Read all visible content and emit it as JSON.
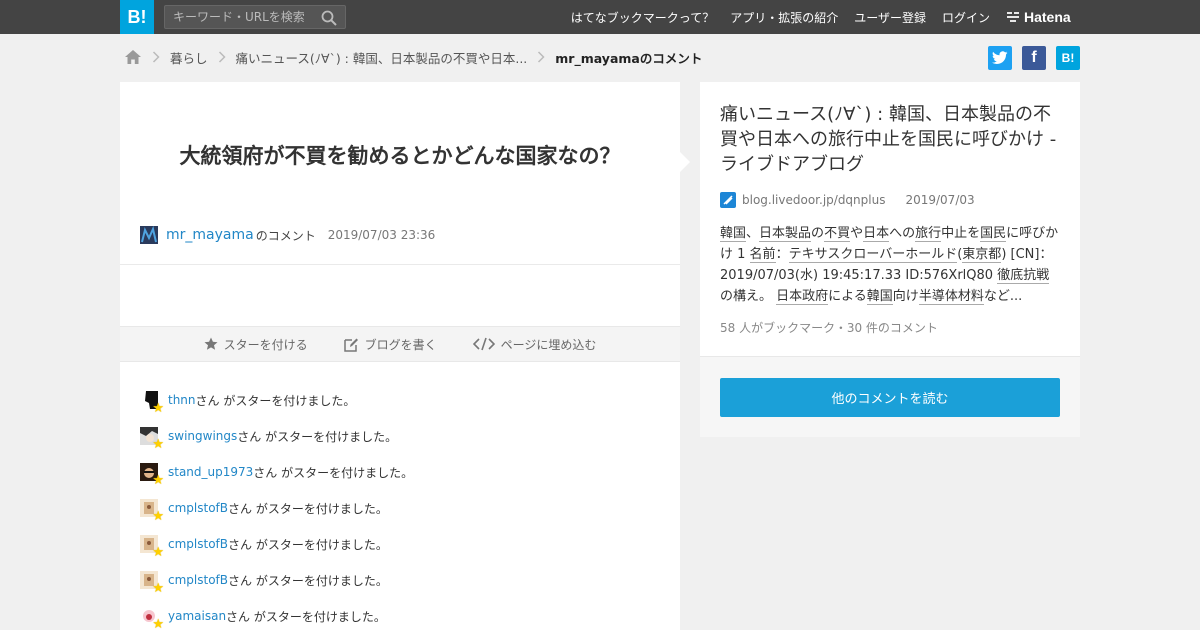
{
  "header": {
    "logo": "B!",
    "search_placeholder": "キーワード・URLを検索",
    "nav": [
      "はてなブックマークって？",
      "アプリ・拡張の紹介",
      "ユーザー登録",
      "ログイン"
    ],
    "brand": "Hatena"
  },
  "breadcrumb": {
    "items": [
      "暮らし",
      "痛いニュース(ﾉ∀`) : 韓国、日本製品の不買や日本..."
    ],
    "current": "mr_mayamaのコメント"
  },
  "share": {
    "twitter": "t",
    "facebook": "f",
    "hatena": "B!"
  },
  "comment": {
    "text": "大統領府が不買を勧めるとかどんな国家なの？",
    "user": "mr_mayama",
    "suffix": "のコメント",
    "date": "2019/07/03 23:36"
  },
  "actions": {
    "star": "スターを付ける",
    "blog": "ブログを書く",
    "embed": "ページに埋め込む"
  },
  "star_suffix": "さん がスターを付けました。",
  "stars": [
    {
      "user": "thnn"
    },
    {
      "user": "swingwings"
    },
    {
      "user": "stand_up1973"
    },
    {
      "user": "cmplstofB"
    },
    {
      "user": "cmplstofB"
    },
    {
      "user": "cmplstofB"
    },
    {
      "user": "yamaisan"
    }
  ],
  "entry": {
    "title": "痛いニュース(ﾉ∀`) : 韓国、日本製品の不買や日本への旅行中止を国民に呼びかけ - ライブドアブログ",
    "domain": "blog.livedoor.jp/dqnplus",
    "date": "2019/07/03",
    "desc_parts": [
      {
        "t": "韓国",
        "u": true
      },
      {
        "t": "、",
        "u": false
      },
      {
        "t": "日本製品",
        "u": true
      },
      {
        "t": "の",
        "u": false
      },
      {
        "t": "不買",
        "u": true
      },
      {
        "t": "や",
        "u": false
      },
      {
        "t": "日本",
        "u": true
      },
      {
        "t": "への",
        "u": false
      },
      {
        "t": "旅行",
        "u": true
      },
      {
        "t": "中止を",
        "u": false
      },
      {
        "t": "国民",
        "u": true
      },
      {
        "t": "に呼びかけ 1 ",
        "u": false
      },
      {
        "t": "名前",
        "u": true
      },
      {
        "t": "：",
        "u": false
      },
      {
        "t": "テキサス",
        "u": true
      },
      {
        "t": "クローバー",
        "u": true
      },
      {
        "t": "ホールド",
        "u": true
      },
      {
        "t": "(",
        "u": false
      },
      {
        "t": "東京都",
        "u": true
      },
      {
        "t": ") [CN]：2019/07/03(水) 19:45:17.33 ID:576XrlQ80 ",
        "u": false
      },
      {
        "t": "徹底抗戦",
        "u": true
      },
      {
        "t": "の構え。 ",
        "u": false
      },
      {
        "t": "日本政府",
        "u": true
      },
      {
        "t": "による",
        "u": false
      },
      {
        "t": "韓国",
        "u": true
      },
      {
        "t": "向け",
        "u": false
      },
      {
        "t": "半導体材料",
        "u": true
      },
      {
        "t": "など...",
        "u": false
      }
    ],
    "count": "58 人がブックマーク・30 件のコメント"
  },
  "more_button": "他のコメントを読む",
  "colors": {
    "accent": "#00a4de",
    "link": "#2287c7",
    "twitter": "#1da1f2",
    "facebook": "#3b5998"
  }
}
